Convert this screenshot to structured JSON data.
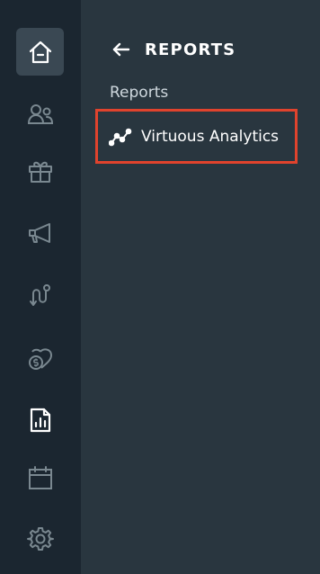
{
  "rail": {
    "items": [
      {
        "icon": "home-icon",
        "active": true
      },
      {
        "icon": "people-icon",
        "active": false
      },
      {
        "icon": "gift-icon",
        "active": false
      },
      {
        "icon": "megaphone-icon",
        "active": false
      },
      {
        "icon": "journey-icon",
        "active": false
      },
      {
        "icon": "donation-heart-icon",
        "active": false
      },
      {
        "icon": "report-document-icon",
        "active": false
      },
      {
        "icon": "calendar-icon",
        "active": false
      },
      {
        "icon": "gear-icon",
        "active": false
      }
    ]
  },
  "panel": {
    "back_icon": "arrow-left-icon",
    "title": "REPORTS",
    "section_label": "Reports",
    "link": {
      "icon": "line-chart-icon",
      "label": "Virtuous Analytics"
    }
  },
  "colors": {
    "rail_bg": "#1b2630",
    "panel_bg": "#29363f",
    "active_bg": "#3a4853",
    "highlight_border": "#e0432d"
  }
}
